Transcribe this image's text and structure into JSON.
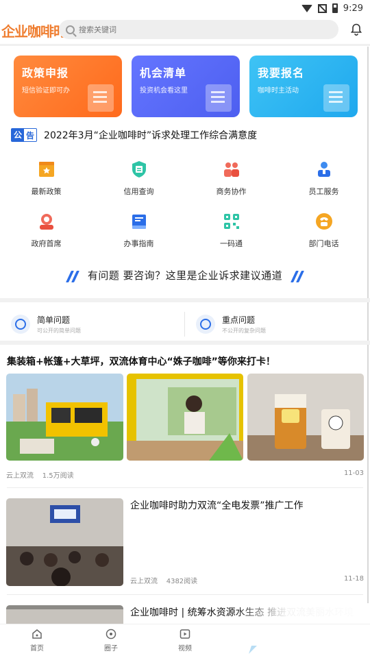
{
  "status": {
    "time": "9:29"
  },
  "header": {
    "logo": "企业咖啡时",
    "search_placeholder": "搜索关键词"
  },
  "cards": [
    {
      "title": "政策申报",
      "subtitle": "短信验证即可办"
    },
    {
      "title": "机会清单",
      "subtitle": "投资机会看这里"
    },
    {
      "title": "我要报名",
      "subtitle": "咖啡时主活动"
    }
  ],
  "notice": {
    "badge_left": "公",
    "badge_right": "告",
    "text": "2022年3月“企业咖啡时”诉求处理工作综合满意度"
  },
  "grid": [
    {
      "label": "最新政策",
      "icon": "policy-icon"
    },
    {
      "label": "信用查询",
      "icon": "credit-icon"
    },
    {
      "label": "商务协作",
      "icon": "cooperation-icon"
    },
    {
      "label": "员工服务",
      "icon": "staff-icon"
    },
    {
      "label": "政府首席",
      "icon": "government-icon"
    },
    {
      "label": "办事指南",
      "icon": "guide-icon"
    },
    {
      "label": "一码通",
      "icon": "qrcode-icon"
    },
    {
      "label": "部门电话",
      "icon": "phone-icon"
    }
  ],
  "consult": {
    "text": "有问题 要咨询？这里是企业诉求建议通道"
  },
  "questions": [
    {
      "title": "简单问题",
      "subtitle": "可公开的简单问题"
    },
    {
      "title": "重点问题",
      "subtitle": "不公开的复杂问题"
    }
  ],
  "articles": [
    {
      "title": "集装箱+帐篷+大草坪，双流体育中心“姝子咖啡”等你来打卡！",
      "source": "云上双流",
      "reads": "1.5万阅读",
      "date": "11-03"
    },
    {
      "title": "企业咖啡时助力双流“全电发票”推广工作",
      "source": "云上双流",
      "reads": "4382阅读",
      "date": "11-18"
    },
    {
      "title": "企业咖啡时 | 统筹水资源水生态 推进双流美丽水环境"
    }
  ],
  "tabs": [
    {
      "label": "首页"
    },
    {
      "label": "圈子"
    },
    {
      "label": "视频"
    }
  ],
  "colors": {
    "accent": "#2b6ee8",
    "brand": "#ef7d2f",
    "orange": "#ff7b2e",
    "purple": "#5568f5",
    "cyan": "#2cb3f0"
  }
}
